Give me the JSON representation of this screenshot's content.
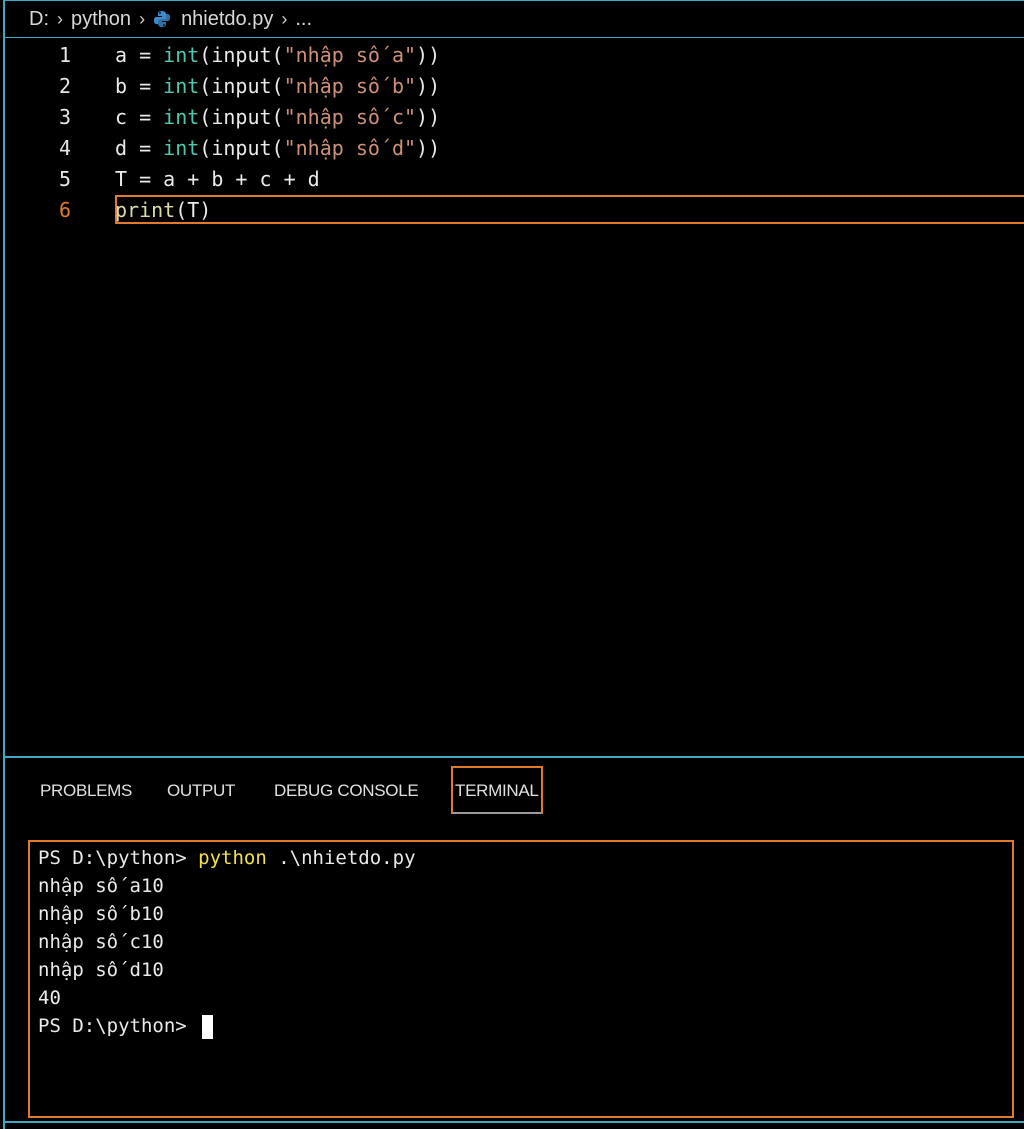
{
  "breadcrumb": {
    "drive": "D:",
    "folder": "python",
    "file": "nhietdo.py",
    "more": "..."
  },
  "editor": {
    "lines": [
      {
        "num": "1",
        "var": "a",
        "op": " = ",
        "kw": "int",
        "fn": "(input(",
        "str": "\"nhập số a\"",
        "end": "))"
      },
      {
        "num": "2",
        "var": "b",
        "op": " = ",
        "kw": "int",
        "fn": "(input(",
        "str": "\"nhập số b\"",
        "end": "))"
      },
      {
        "num": "3",
        "var": "c",
        "op": " = ",
        "kw": "int",
        "fn": "(input(",
        "str": "\"nhập số c\"",
        "end": "))"
      },
      {
        "num": "4",
        "var": "d",
        "op": " = ",
        "kw": "int",
        "fn": "(input(",
        "str": "\"nhập số d\"",
        "end": "))"
      },
      {
        "num": "5",
        "text": "T = a + b + c + d"
      },
      {
        "num": "6",
        "fn": "print",
        "text": "(T)"
      }
    ],
    "active_line": "6"
  },
  "panel": {
    "tabs": [
      "PROBLEMS",
      "OUTPUT",
      "DEBUG CONSOLE",
      "TERMINAL"
    ],
    "active_tab": "TERMINAL"
  },
  "terminal": {
    "prompt": "PS D:\\python> ",
    "command": "python",
    "args": " .\\nhietdo.py",
    "output": [
      "nhập số a10",
      "nhập số b10",
      "nhập số c10",
      "nhập số d10",
      "40"
    ],
    "final_prompt": "PS D:\\python> "
  }
}
